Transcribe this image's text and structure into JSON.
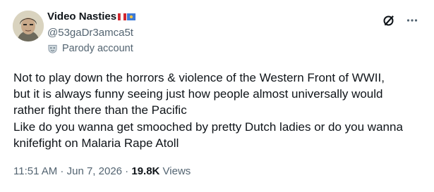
{
  "author": {
    "display_name": "Video Nasties",
    "name_badges": [
      "tricolour-flag-icon",
      "blue-flag-icon"
    ],
    "handle": "@53gaDr3amca5t",
    "parody_label": "Parody account"
  },
  "actions": {
    "grok_icon": "grok-icon",
    "more_icon": "more-icon"
  },
  "post": {
    "lines": [
      "Not to play down the horrors & violence of the Western Front of WWII,",
      "but it is always funny seeing just how people almost universally would",
      "rather fight there than the Pacific",
      "Like do you wanna get smooched by pretty Dutch ladies or do you wanna",
      "knifefight on Malaria Rape Atoll"
    ]
  },
  "meta": {
    "time": "11:51 AM",
    "separator_1": " · ",
    "date": "Jun 7, 2026",
    "separator_2": " · ",
    "views_count": "19.8K",
    "views_label": " Views"
  },
  "colors": {
    "text_primary": "#0f1419",
    "text_secondary": "#536471",
    "background": "#ffffff"
  }
}
